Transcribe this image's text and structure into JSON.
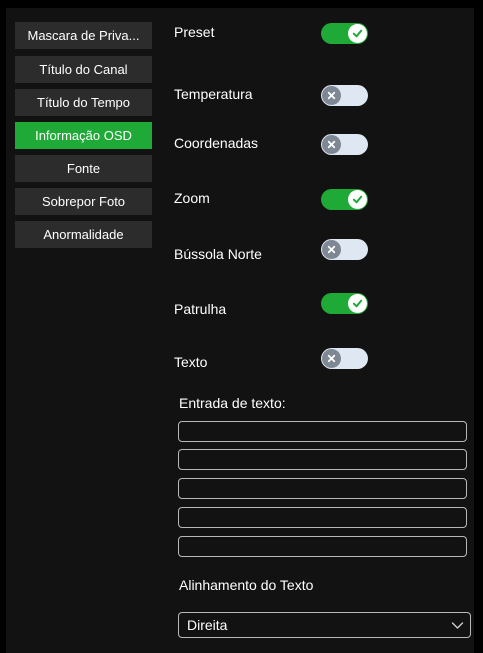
{
  "sidebar": {
    "items": [
      {
        "label": "Mascara de Priva..."
      },
      {
        "label": "Título do Canal"
      },
      {
        "label": "Título do Tempo"
      },
      {
        "label": "Informação OSD",
        "active": true
      },
      {
        "label": "Fonte"
      },
      {
        "label": "Sobrepor Foto"
      },
      {
        "label": "Anormalidade"
      }
    ]
  },
  "options": [
    {
      "label": "Preset",
      "state": "on"
    },
    {
      "label": "Temperatura",
      "state": "off"
    },
    {
      "label": "Coordenadas",
      "state": "off"
    },
    {
      "label": "Zoom",
      "state": "on"
    },
    {
      "label": "Bússola Norte",
      "state": "off"
    },
    {
      "label": "Patrulha",
      "state": "on"
    },
    {
      "label": "Texto",
      "state": "off"
    }
  ],
  "text_entry": {
    "label": "Entrada de texto:",
    "fields": [
      "",
      "",
      "",
      "",
      ""
    ]
  },
  "alignment": {
    "label": "Alinhamento do Texto",
    "selected": "Direita"
  },
  "colors": {
    "accent": "#1faa38",
    "toggle_off": "#dfe7f2",
    "sidebar_item": "#2c2c2c",
    "panel_bg": "#121212"
  },
  "icons": {
    "toggle_on": "check-icon",
    "toggle_off": "x-icon",
    "dropdown": "chevron-down-icon"
  }
}
